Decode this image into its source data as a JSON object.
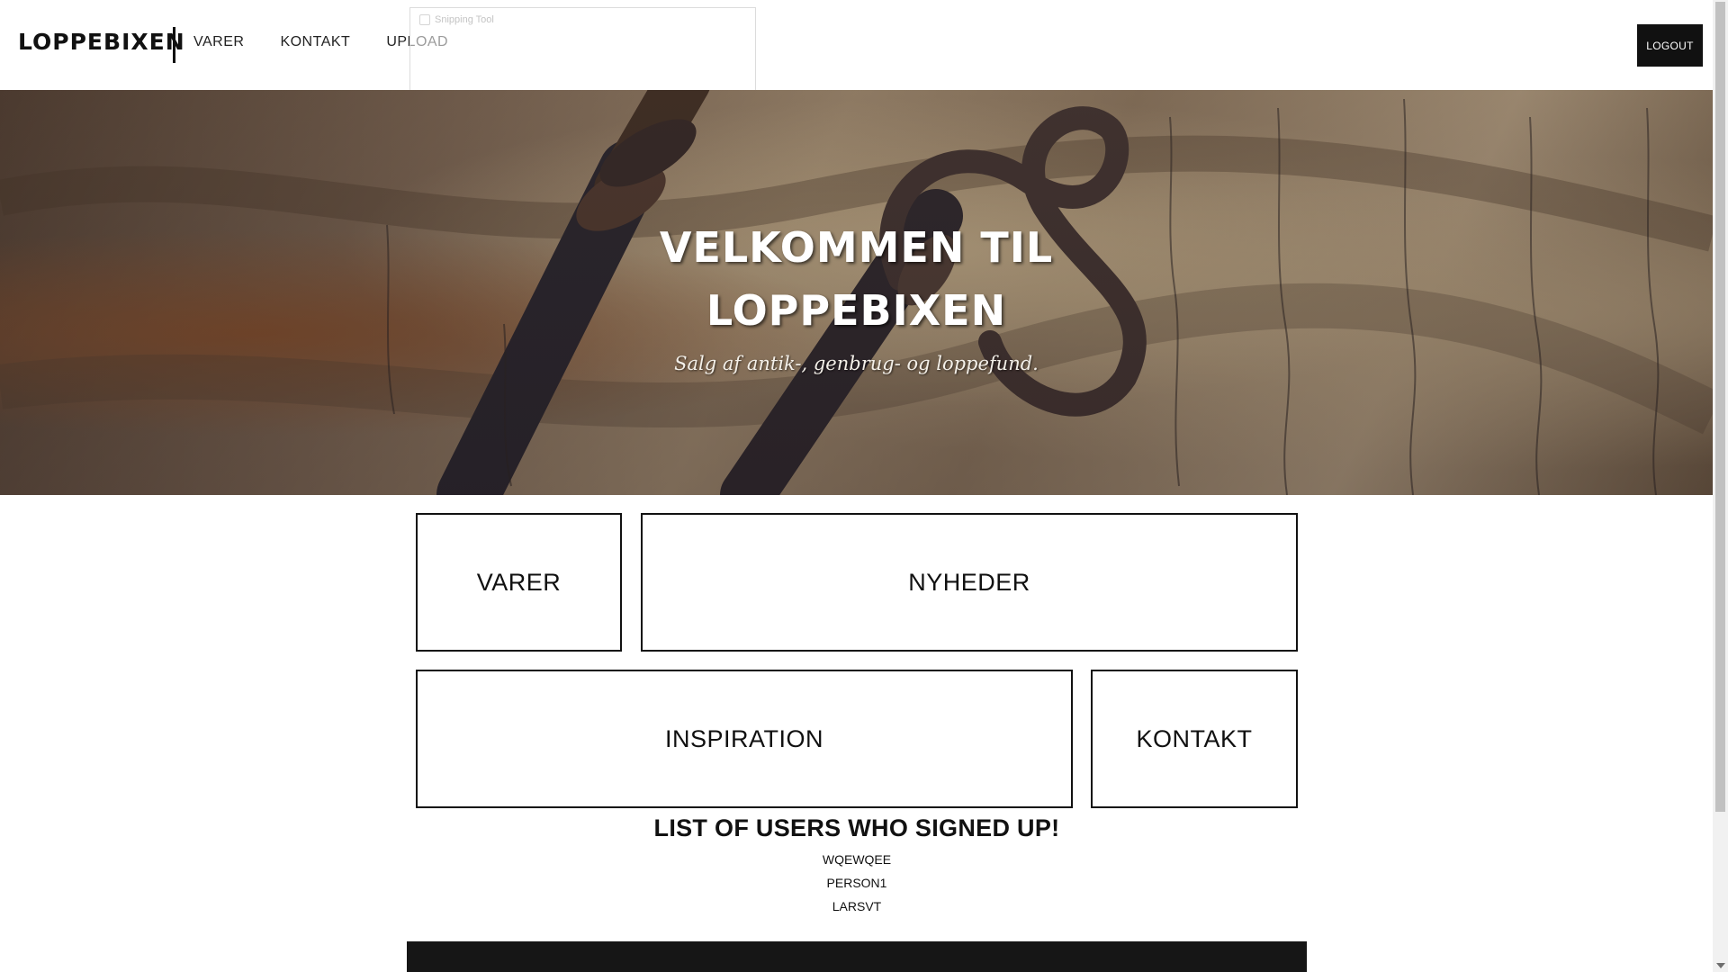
{
  "header": {
    "brand": "LOPPEBIXEN",
    "nav": [
      {
        "label": "VARER"
      },
      {
        "label": "KONTAKT"
      },
      {
        "label": "UPLOAD"
      }
    ],
    "logout_label": "LOGOUT"
  },
  "overlay": {
    "snipping_tool_title": "Snipping Tool"
  },
  "hero": {
    "title": "VELKOMMEN TIL LOPPEBIXEN",
    "subtitle": "Salg af antik-, genbrug- og loppefund."
  },
  "tiles": {
    "varer": "VARER",
    "nyheder": "NYHEDER",
    "inspiration": "INSPIRATION",
    "kontakt": "KONTAKT"
  },
  "users": {
    "title": "LIST OF USERS WHO SIGNED UP!",
    "list": [
      "WQEWQEE",
      "PERSON1",
      "LARSVT"
    ]
  },
  "colors": {
    "primary": "#111111",
    "background": "#ffffff",
    "footer": "#161616"
  },
  "icons": {
    "hero_image": "antique-keys-image",
    "snip_icon": "snipping-tool-icon",
    "scroll_down": "chevron-down-icon"
  }
}
